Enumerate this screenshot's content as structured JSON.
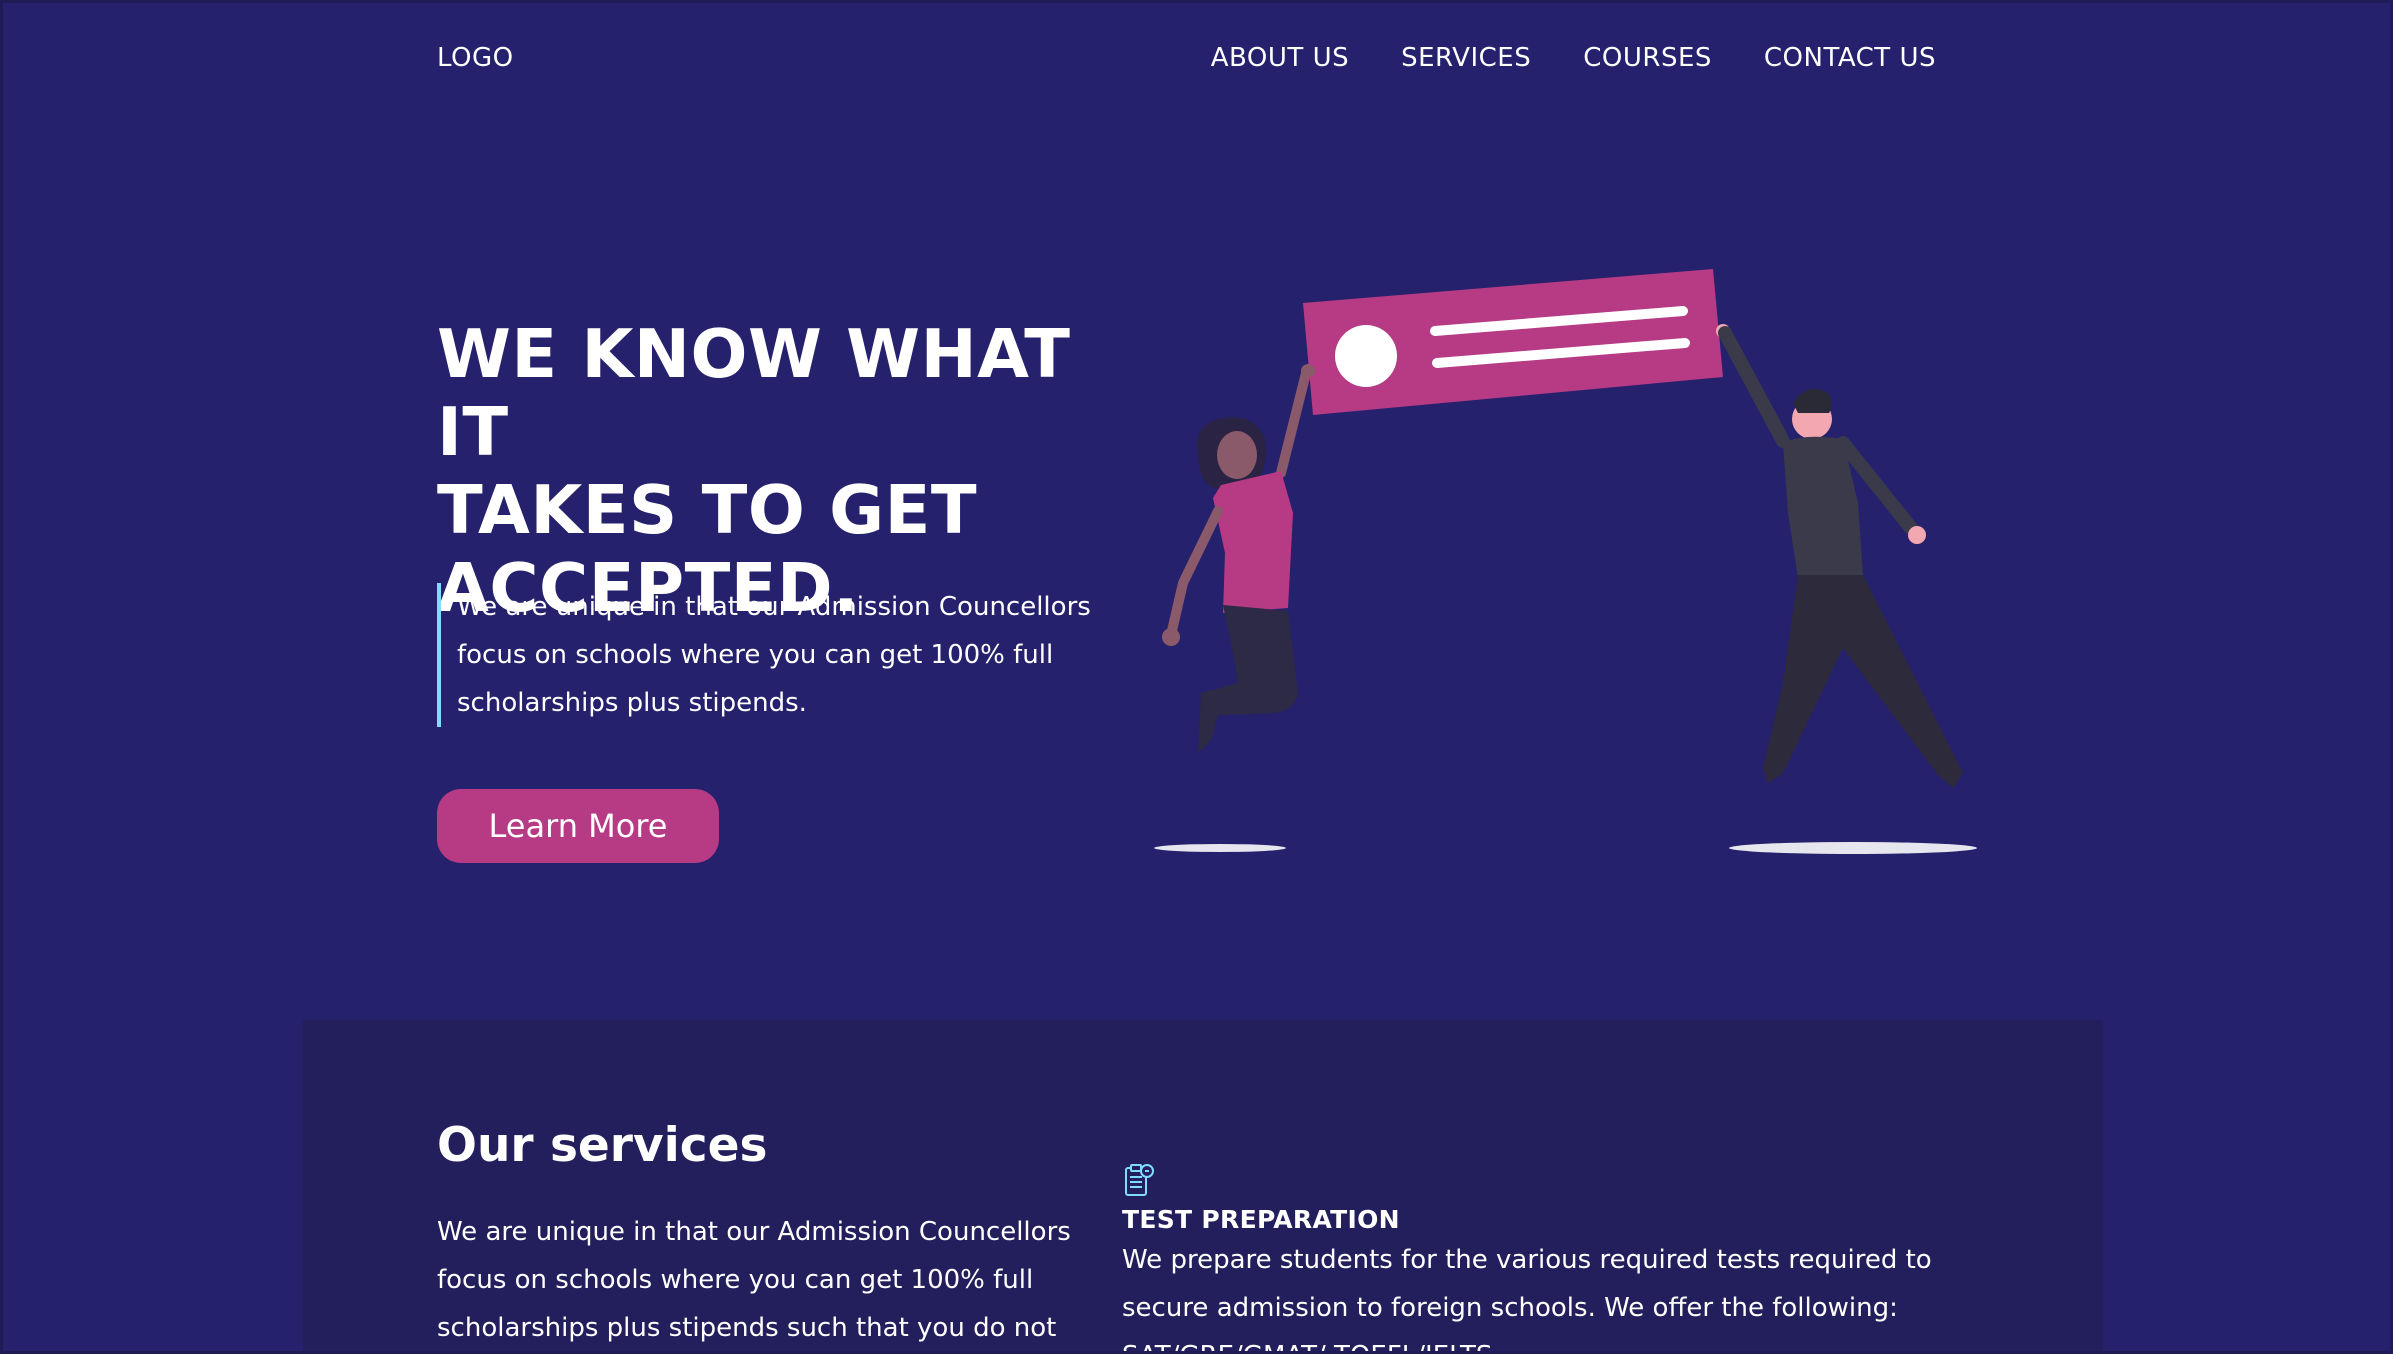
{
  "header": {
    "logo": "LOGO",
    "nav": [
      "ABOUT US",
      "SERVICES",
      "COURSES",
      "CONTACT US"
    ]
  },
  "hero": {
    "title_lines": [
      "WE KNOW WHAT IT",
      "TAKES TO GET",
      "ACCEPTED."
    ],
    "quote": "We are unique in that our Admission Councellors focus on schools where you can get 100% full scholarships plus stipends.",
    "cta": "Learn More"
  },
  "services": {
    "title": "Our services",
    "text": "We are unique in that our Admission Councellors focus on schools where you can get 100% full scholarships plus stipends such that you do not",
    "item": {
      "icon": "clipboard-icon",
      "title": "TEST PREPARATION",
      "text": "We prepare students for the various required tests required to secure admission to foreign schools. We offer the following: SAT/GRE/GMAT/ TOEFL/IELTS"
    }
  },
  "colors": {
    "background": "#25216d",
    "section": "#231f5c",
    "accent": "#b73a85",
    "quote_border": "#7fdcff"
  }
}
